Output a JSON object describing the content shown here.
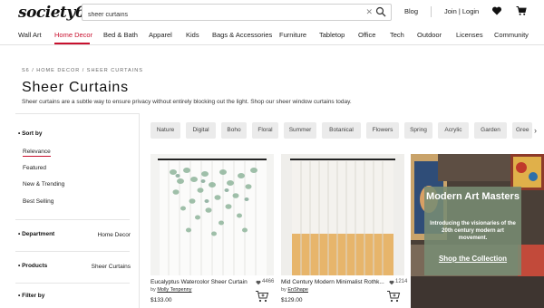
{
  "header": {
    "logo": "society6",
    "search_value": "sheer curtains",
    "blog": "Blog",
    "join_login": "Join | Login"
  },
  "nav": [
    "Wall Art",
    "Home Decor",
    "Bed & Bath",
    "Apparel",
    "Kids",
    "Bags & Accessories",
    "Furniture",
    "Tabletop",
    "Office",
    "Tech",
    "Outdoor",
    "Licenses",
    "Community"
  ],
  "page": {
    "breadcrumb": "S6 / HOME DECOR / SHEER CURTAINS",
    "title": "Sheer Curtains",
    "description": "Sheer curtains are a subtle way to ensure privacy without entirely blocking out the light. Shop our sheer window curtains today."
  },
  "sidebar": {
    "sort_head": "Sort by",
    "sort_options": [
      "Relevance",
      "Featured",
      "New & Trending",
      "Best Selling"
    ],
    "department_head": "Department",
    "department_value": "Home Decor",
    "products_head": "Products",
    "products_value": "Sheer Curtains",
    "filter_head": "Filter by"
  },
  "chips": [
    "Nature",
    "Digital",
    "Boho",
    "Floral",
    "Summer",
    "Botanical",
    "Flowers",
    "Spring",
    "Acrylic",
    "Garden",
    "Gree"
  ],
  "products": [
    {
      "title": "Eucalyptus Watercolor Sheer Curtain",
      "likes": "4466",
      "by": "by",
      "artist": "Molly Tenpenny",
      "price": "$133.00"
    },
    {
      "title": "Mid Century Modern Minimalist Rothk...",
      "likes": "1214",
      "by": "by",
      "artist": "EnShape",
      "price": "$129.00"
    }
  ],
  "promo": {
    "title": "Modern Art Masters",
    "subtitle": "Introducing the visionaries of the 20th century modern art movement.",
    "cta": "Shop the Collection"
  },
  "colors": {
    "accent": "#c8102e",
    "chip_bg": "#ebebeb",
    "promo_overlay": "#788c73"
  }
}
